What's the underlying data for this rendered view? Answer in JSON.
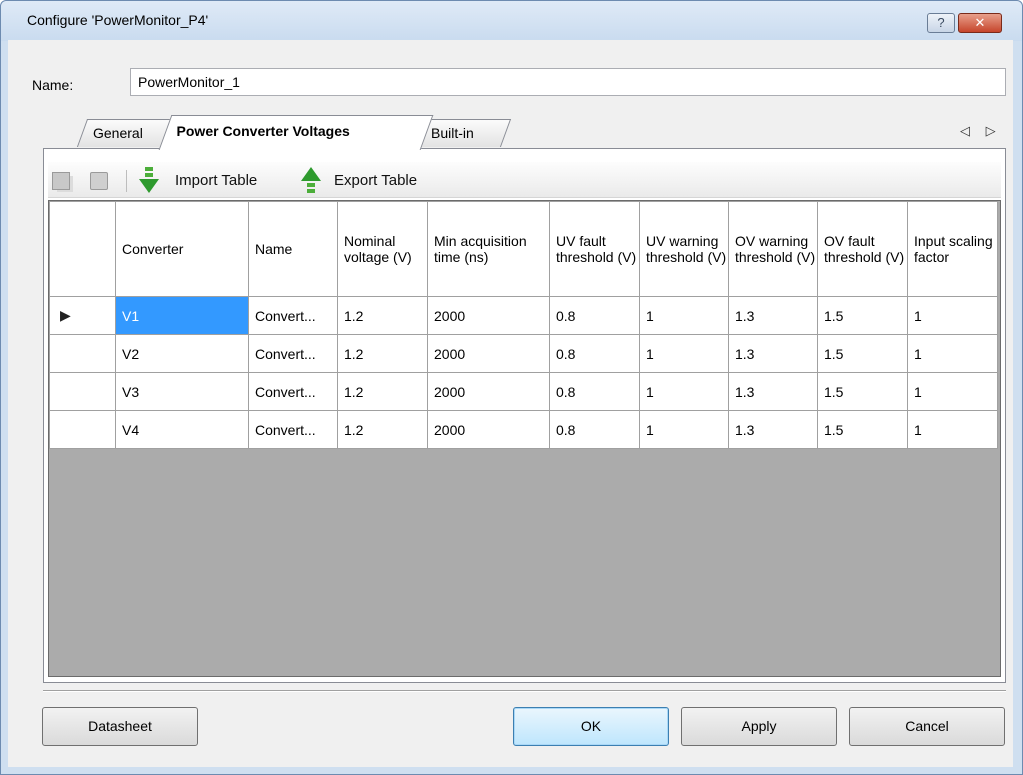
{
  "window": {
    "title": "Configure 'PowerMonitor_P4'",
    "help_glyph": "?",
    "close_glyph": "✕"
  },
  "name_field": {
    "label": "Name:",
    "value": "PowerMonitor_1"
  },
  "tabs": [
    {
      "label": "General",
      "active": false
    },
    {
      "label": "Power Converter Voltages",
      "active": true
    },
    {
      "label": "Built-in",
      "active": false
    }
  ],
  "tab_nav": "◁ ▷",
  "toolbar": {
    "import_label": "Import Table",
    "export_label": "Export Table",
    "import_icon": "arrow-down-icon",
    "export_icon": "arrow-up-icon"
  },
  "table": {
    "columns": [
      "Converter",
      "Name",
      "Nominal voltage (V)",
      "Min acquisition time (ns)",
      "UV fault threshold (V)",
      "UV warning threshold (V)",
      "OV warning threshold (V)",
      "OV fault threshold (V)",
      "Input scaling factor"
    ],
    "current_row_marker": "▶",
    "rows": [
      [
        "V1",
        "Convert...",
        "1.2",
        "2000",
        "0.8",
        "1",
        "1.3",
        "1.5",
        "1"
      ],
      [
        "V2",
        "Convert...",
        "1.2",
        "2000",
        "0.8",
        "1",
        "1.3",
        "1.5",
        "1"
      ],
      [
        "V3",
        "Convert...",
        "1.2",
        "2000",
        "0.8",
        "1",
        "1.3",
        "1.5",
        "1"
      ],
      [
        "V4",
        "Convert...",
        "1.2",
        "2000",
        "0.8",
        "1",
        "1.3",
        "1.5",
        "1"
      ]
    ]
  },
  "buttons": {
    "datasheet": "Datasheet",
    "ok": "OK",
    "apply": "Apply",
    "cancel": "Cancel"
  },
  "colors": {
    "selection": "#3399ff",
    "grid_background": "#ababab",
    "title_bar": "#c9dbef"
  }
}
